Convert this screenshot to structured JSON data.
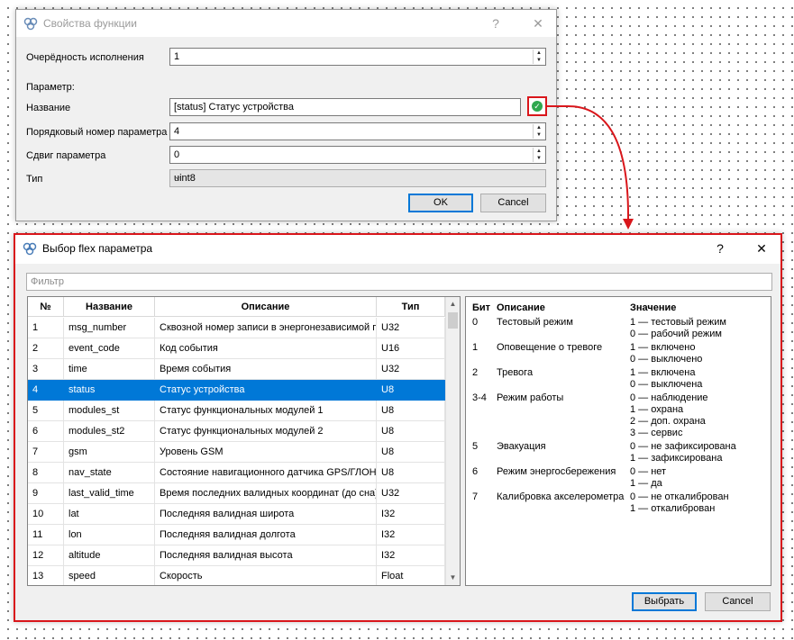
{
  "props_dialog": {
    "title": "Свойства функции",
    "help": "?",
    "close": "✕",
    "order_label": "Очерёдность исполнения",
    "order_value": "1",
    "param_header": "Параметр:",
    "name_label": "Название",
    "name_value": "[status] Статус устройства",
    "index_label": "Порядковый номер параметра",
    "index_value": "4",
    "shift_label": "Сдвиг параметра",
    "shift_value": "0",
    "type_label": "Тип",
    "type_value": "uint8",
    "ok": "OK",
    "cancel": "Cancel"
  },
  "flex_dialog": {
    "title": "Выбор flex параметра",
    "help": "?",
    "close": "✕",
    "filter_placeholder": "Фильтр",
    "columns": [
      "№",
      "Название",
      "Описание",
      "Тип"
    ],
    "rows": [
      {
        "n": "1",
        "name": "msg_number",
        "desc": "Сквозной номер записи в энергонезависимой памяти",
        "type": "U32"
      },
      {
        "n": "2",
        "name": "event_code",
        "desc": "Код события",
        "type": "U16"
      },
      {
        "n": "3",
        "name": "time",
        "desc": "Время события",
        "type": "U32"
      },
      {
        "n": "4",
        "name": "status",
        "desc": "Статус устройства",
        "type": "U8"
      },
      {
        "n": "5",
        "name": "modules_st",
        "desc": "Статус функциональных модулей 1",
        "type": "U8"
      },
      {
        "n": "6",
        "name": "modules_st2",
        "desc": "Статус функциональных модулей 2",
        "type": "U8"
      },
      {
        "n": "7",
        "name": "gsm",
        "desc": "Уровень GSM",
        "type": "U8"
      },
      {
        "n": "8",
        "name": "nav_state",
        "desc": "Состояние навигационного датчика GPS/ГЛОНАСС",
        "type": "U8"
      },
      {
        "n": "9",
        "name": "last_valid_time",
        "desc": "Время последних валидных координат (до сна)",
        "type": "U32"
      },
      {
        "n": "10",
        "name": "lat",
        "desc": "Последняя валидная широта",
        "type": "I32"
      },
      {
        "n": "11",
        "name": "lon",
        "desc": "Последняя валидная долгота",
        "type": "I32"
      },
      {
        "n": "12",
        "name": "altitude",
        "desc": "Последняя валидная высота",
        "type": "I32"
      },
      {
        "n": "13",
        "name": "speed",
        "desc": "Скорость",
        "type": "Float"
      }
    ],
    "selected_row": 3,
    "bits_headers": {
      "bit": "Бит",
      "desc": "Описание",
      "value": "Значение"
    },
    "bits": [
      {
        "bit": "0",
        "desc": "Тестовый режим",
        "values": [
          "1 — тестовый режим",
          "0 — рабочий режим"
        ]
      },
      {
        "bit": "1",
        "desc": "Оповещение о тревоге",
        "values": [
          "1 — включено",
          "0 — выключено"
        ]
      },
      {
        "bit": "2",
        "desc": "Тревога",
        "values": [
          "1 — включена",
          "0 — выключена"
        ]
      },
      {
        "bit": "3-4",
        "desc": "Режим работы",
        "values": [
          "0 — наблюдение",
          "1 — охрана",
          "2 — доп. охрана",
          "3 — сервис"
        ]
      },
      {
        "bit": "5",
        "desc": "Эвакуация",
        "values": [
          "0 — не зафиксирована",
          "1 — зафиксирована"
        ]
      },
      {
        "bit": "6",
        "desc": "Режим энергосбережения",
        "values": [
          "0 — нет",
          "1 — да"
        ]
      },
      {
        "bit": "7",
        "desc": "Калибровка акселерометра",
        "values": [
          "0 — не откалиброван",
          "1 — откалиброван"
        ]
      }
    ],
    "select": "Выбрать",
    "cancel": "Cancel"
  },
  "colors": {
    "accent": "#0078d7",
    "highlight": "#d9161b",
    "success": "#2fa84f"
  }
}
